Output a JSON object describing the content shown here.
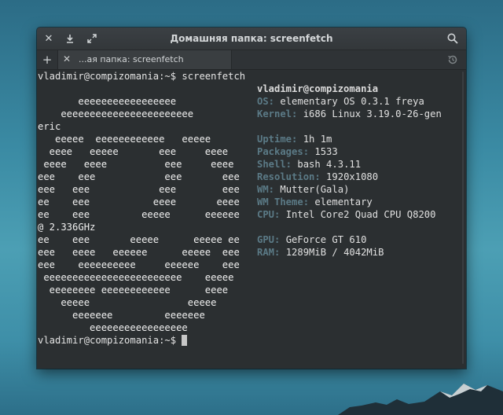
{
  "window": {
    "title": "Домашняя папка: screenfetch",
    "tab_label": "...ая папка: screenfetch"
  },
  "icons": {
    "close": "close-icon",
    "download": "download-icon",
    "maximize": "maximize-icon",
    "search": "search-icon",
    "new_tab": "plus-icon",
    "tab_close": "close-icon",
    "history": "history-icon"
  },
  "terminal": {
    "command_line": "vladimir@compizomania:~$ screenfetch",
    "logo_lines": [
      "       eeeeeeeeeeeeeeeee",
      "    eeeeeeeeeeeeeeeeeeeeeee",
      "",
      "   eeeee  eeeeeeeeeeee   eeeee",
      "  eeee   eeeee       eee     eeee",
      " eeee   eeee          eee     eeee",
      "eee    eee            eee       eee",
      "eee   eee            eee        eee",
      "ee    eee           eeee       eeee",
      "ee    eee         eeeee      eeeeee",
      "",
      "ee    eee       eeeee      eeeee ee",
      "eee   eeee   eeeeee      eeeee  eee",
      "eee    eeeeeeeeee     eeeeee    eee",
      " eeeeeeeeeeeeeeeeeeeeeeee    eeeee",
      "  eeeeeeee eeeeeeeeeeee      eeee",
      "    eeeee                 eeeee",
      "      eeeeeee         eeeeeee",
      "         eeeeeeeeeeeeeeeee"
    ],
    "wrap_kernel": "eric",
    "wrap_cpu": "@ 2.336GHz",
    "user_host": "vladimir@compizomania",
    "info": [
      {
        "label": "OS:",
        "value": " elementary OS 0.3.1 freya"
      },
      {
        "label": "Kernel:",
        "value": " i686 Linux 3.19.0-26-gen"
      },
      {
        "label": "",
        "value": ""
      },
      {
        "label": "Uptime:",
        "value": " 1h 1m"
      },
      {
        "label": "Packages:",
        "value": " 1533"
      },
      {
        "label": "Shell:",
        "value": " bash 4.3.11"
      },
      {
        "label": "Resolution:",
        "value": " 1920x1080"
      },
      {
        "label": "WM:",
        "value": " Mutter(Gala)"
      },
      {
        "label": "WM Theme:",
        "value": " elementary"
      },
      {
        "label": "CPU:",
        "value": " Intel Core2 Quad CPU Q8200"
      },
      {
        "label": "",
        "value": ""
      },
      {
        "label": "GPU:",
        "value": " GeForce GT 610"
      },
      {
        "label": "RAM:",
        "value": " 1289MiB / 4042MiB"
      }
    ],
    "prompt": "vladimir@compizomania:~$ "
  }
}
